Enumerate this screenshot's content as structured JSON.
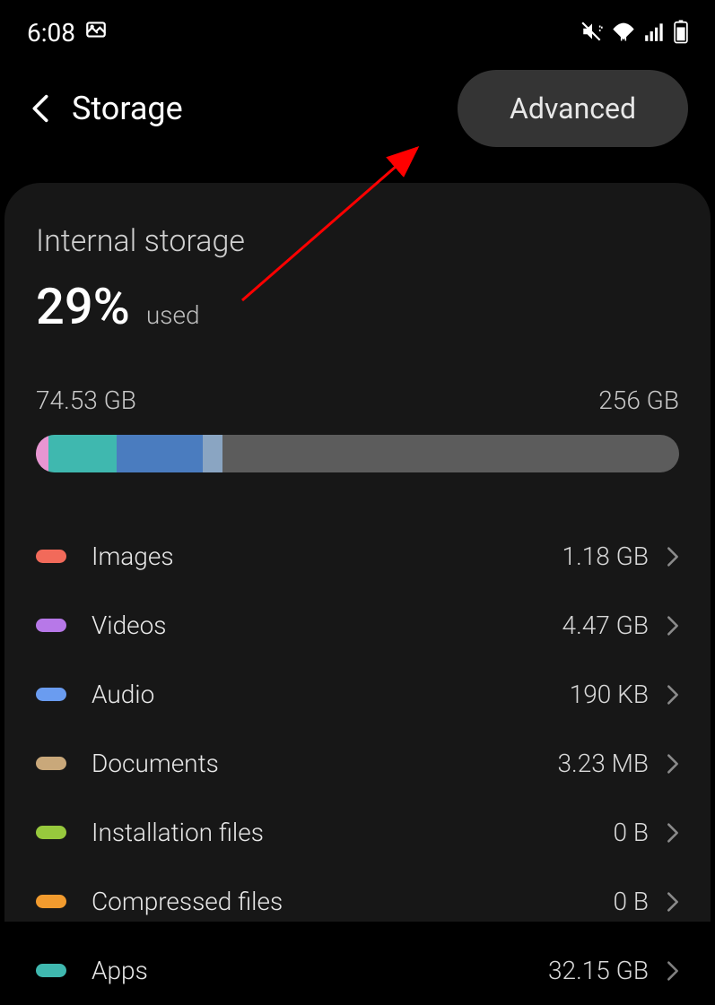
{
  "status": {
    "time": "6:08"
  },
  "header": {
    "title": "Storage",
    "advanced_label": "Advanced"
  },
  "storage": {
    "title": "Internal storage",
    "percent": "29%",
    "used_label": "used",
    "used_size": "74.53 GB",
    "total_size": "256 GB"
  },
  "segments": [
    {
      "color": "#e896d2",
      "width": "2%"
    },
    {
      "color": "#3fb8af",
      "width": "10.5%"
    },
    {
      "color": "#4a7cbf",
      "width": "13.5%"
    },
    {
      "color": "#8aa5c2",
      "width": "3%"
    }
  ],
  "categories": [
    {
      "name": "Images",
      "size": "1.18 GB",
      "color": "#f26a5a"
    },
    {
      "name": "Videos",
      "size": "4.47 GB",
      "color": "#b778e8"
    },
    {
      "name": "Audio",
      "size": "190 KB",
      "color": "#6a9cf0"
    },
    {
      "name": "Documents",
      "size": "3.23 MB",
      "color": "#c9a87a"
    },
    {
      "name": "Installation files",
      "size": "0 B",
      "color": "#97c93d"
    },
    {
      "name": "Compressed files",
      "size": "0 B",
      "color": "#f29b2e"
    },
    {
      "name": "Apps",
      "size": "32.15 GB",
      "color": "#3fb8af"
    }
  ]
}
